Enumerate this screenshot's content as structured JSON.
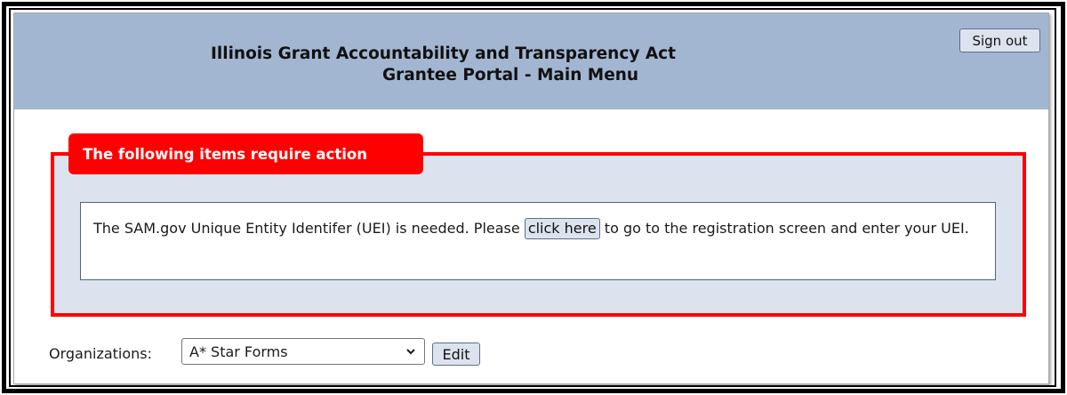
{
  "header": {
    "title_line1": "Illinois Grant Accountability and Transparency Act",
    "title_line2": "Grantee Portal - Main Menu",
    "sign_out_label": "Sign out",
    "background_color": "#a3b6d1"
  },
  "action_panel": {
    "legend": "The following items require action",
    "accent_color": "#ff0000",
    "message": {
      "text_before": "The SAM.gov Unique Entity Identifer (UEI) is needed. Please ",
      "button_label": "click here",
      "text_after": " to go to the registration screen and enter your UEI."
    }
  },
  "organizations": {
    "label": "Organizations:",
    "selected": "A* Star Forms",
    "dropdown_icon": "chevron-down-icon",
    "edit_label": "Edit"
  }
}
